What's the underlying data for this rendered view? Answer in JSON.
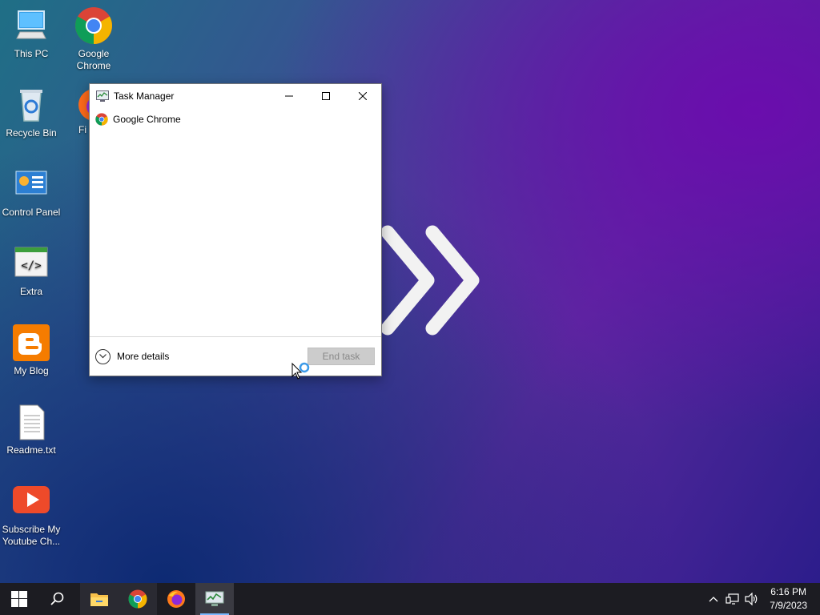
{
  "desktop": {
    "icons": [
      {
        "label": "This PC"
      },
      {
        "label": "Google Chrome"
      },
      {
        "label": "Recycle Bin"
      },
      {
        "label": "Fi"
      },
      {
        "label": "Control Panel"
      },
      {
        "label": "Extra"
      },
      {
        "label": "My Blog"
      },
      {
        "label": "Readme.txt"
      },
      {
        "label": "Subscribe My Youtube Ch..."
      }
    ]
  },
  "task_manager": {
    "title": "Task Manager",
    "processes": [
      {
        "name": "Google Chrome",
        "icon": "chrome-icon"
      }
    ],
    "more_details_label": "More details",
    "end_task_label": "End task"
  },
  "taskbar": {
    "pinned": [
      {
        "name": "start-button",
        "icon": "windows-logo-icon"
      },
      {
        "name": "search-button",
        "icon": "search-icon"
      },
      {
        "name": "file-explorer",
        "icon": "folder-icon"
      },
      {
        "name": "chrome",
        "icon": "chrome-icon"
      },
      {
        "name": "firefox",
        "icon": "firefox-icon"
      },
      {
        "name": "task-manager",
        "icon": "task-manager-icon",
        "active": true
      }
    ],
    "clock": {
      "time": "6:16 PM",
      "date": "7/9/2023"
    }
  },
  "colors": {
    "taskbar_bg": "#1c1c22",
    "accent": "#7ab8ff",
    "end_task_disabled": "#cccccc"
  }
}
